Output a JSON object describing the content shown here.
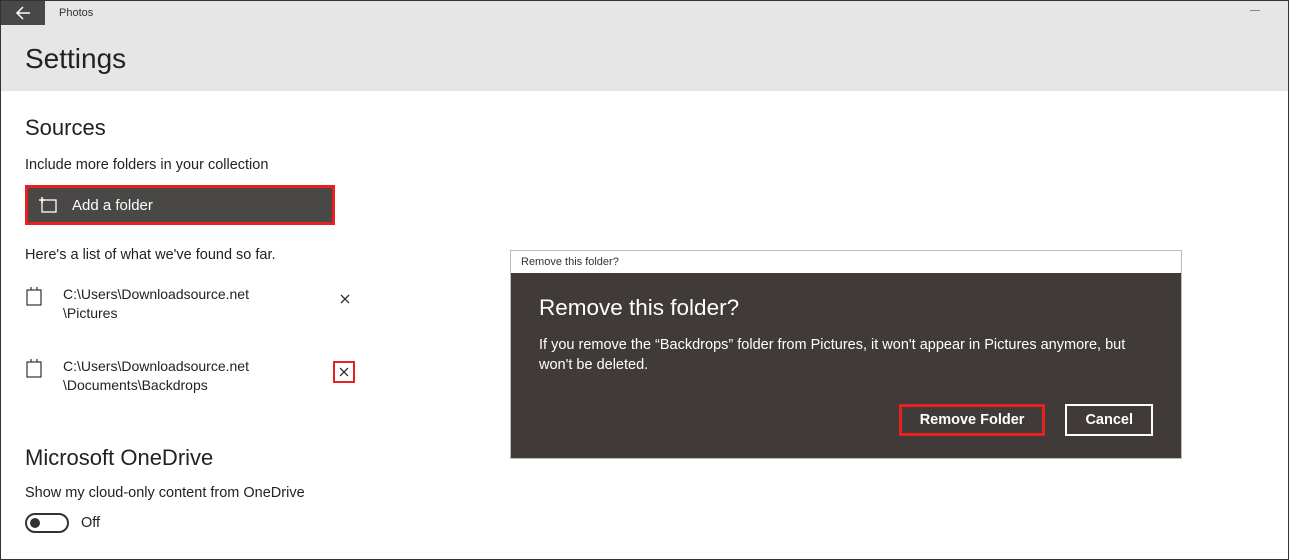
{
  "app": {
    "title": "Photos"
  },
  "header": {
    "title": "Settings"
  },
  "sources": {
    "heading": "Sources",
    "hint": "Include more folders in your collection",
    "add_label": "Add a folder",
    "found_label": "Here's a list of what we've found so far.",
    "folders": [
      {
        "path_line1": "C:\\Users\\Downloadsource.net",
        "path_line2": "\\Pictures",
        "highlight_remove": false
      },
      {
        "path_line1": "C:\\Users\\Downloadsource.net",
        "path_line2": "\\Documents\\Backdrops",
        "highlight_remove": true
      }
    ]
  },
  "onedrive": {
    "heading": "Microsoft OneDrive",
    "hint": "Show my cloud-only content from OneDrive",
    "toggle_state": "Off"
  },
  "dialog": {
    "bar": "Remove this folder?",
    "title": "Remove this folder?",
    "text": "If you remove the “Backdrops” folder from Pictures, it won't appear in Pictures anymore, but won't be deleted.",
    "primary": "Remove Folder",
    "secondary": "Cancel"
  },
  "colors": {
    "accent_highlight": "#e82020",
    "dark_bg": "#4a4846",
    "dialog_bg": "#403b38"
  }
}
